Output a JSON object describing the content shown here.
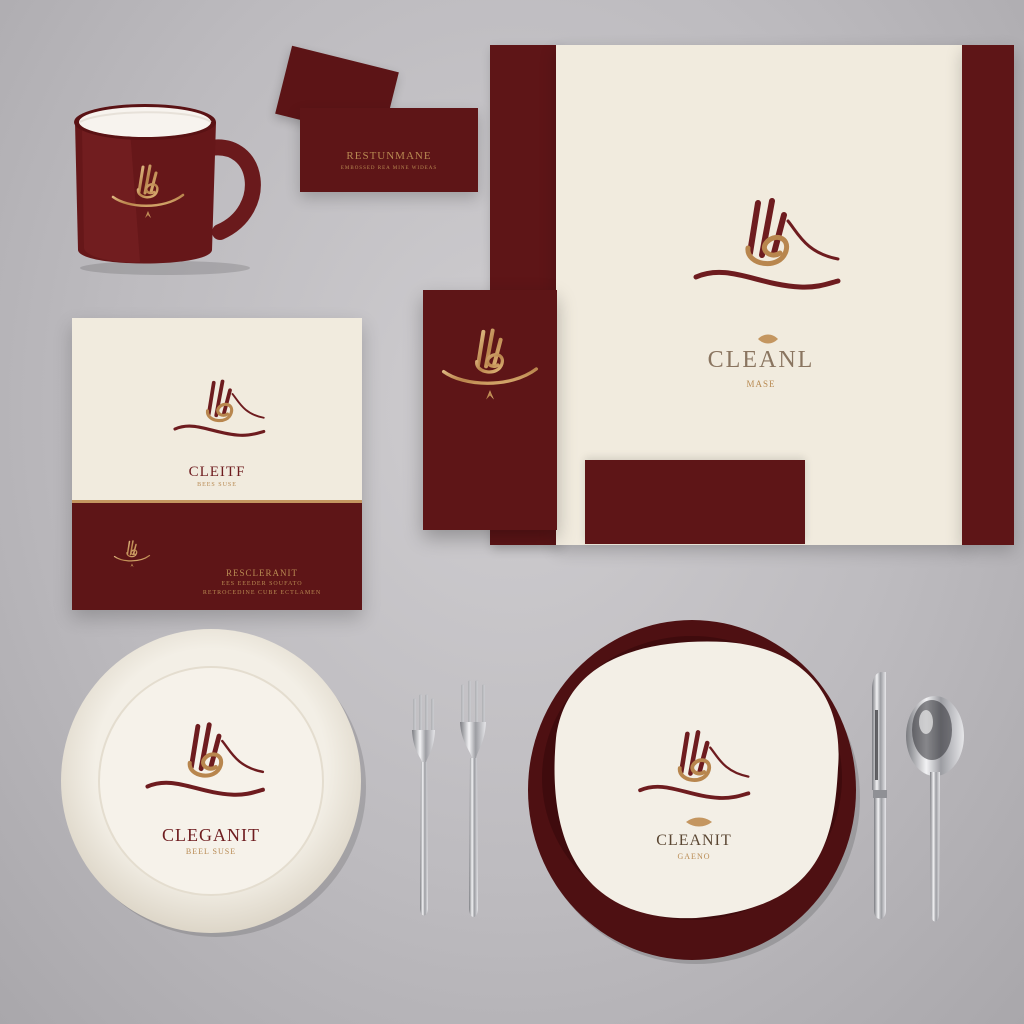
{
  "palette": {
    "burgundy": "#5f1517",
    "cream": "#f1ebde",
    "gold": "#c49660",
    "backdrop": "#bdbbbf"
  },
  "card": {
    "title": "RESTUNMANE",
    "subtitle": "EMBOSSED REA MINE WIDEAS"
  },
  "notebook": {
    "brand": "CLEITF",
    "subtitle": "BEES SUSE",
    "band_title": "RESCLERANIT",
    "band_line1": "EES EEEDER SOUFATO",
    "band_line2": "RETROCEDINE CUBE ECTLAMEN"
  },
  "folder": {
    "brand": "CLEANL",
    "subtitle": "MASE"
  },
  "plate_left": {
    "brand": "CLEGANIT",
    "subtitle": "BEEL SUSE"
  },
  "plate_right": {
    "brand": "CLEANIT",
    "subtitle": "GAENO"
  },
  "icons": [
    "mug-icon",
    "calligraphy-logo-icon",
    "fork-icon",
    "knife-icon",
    "spoon-icon"
  ]
}
